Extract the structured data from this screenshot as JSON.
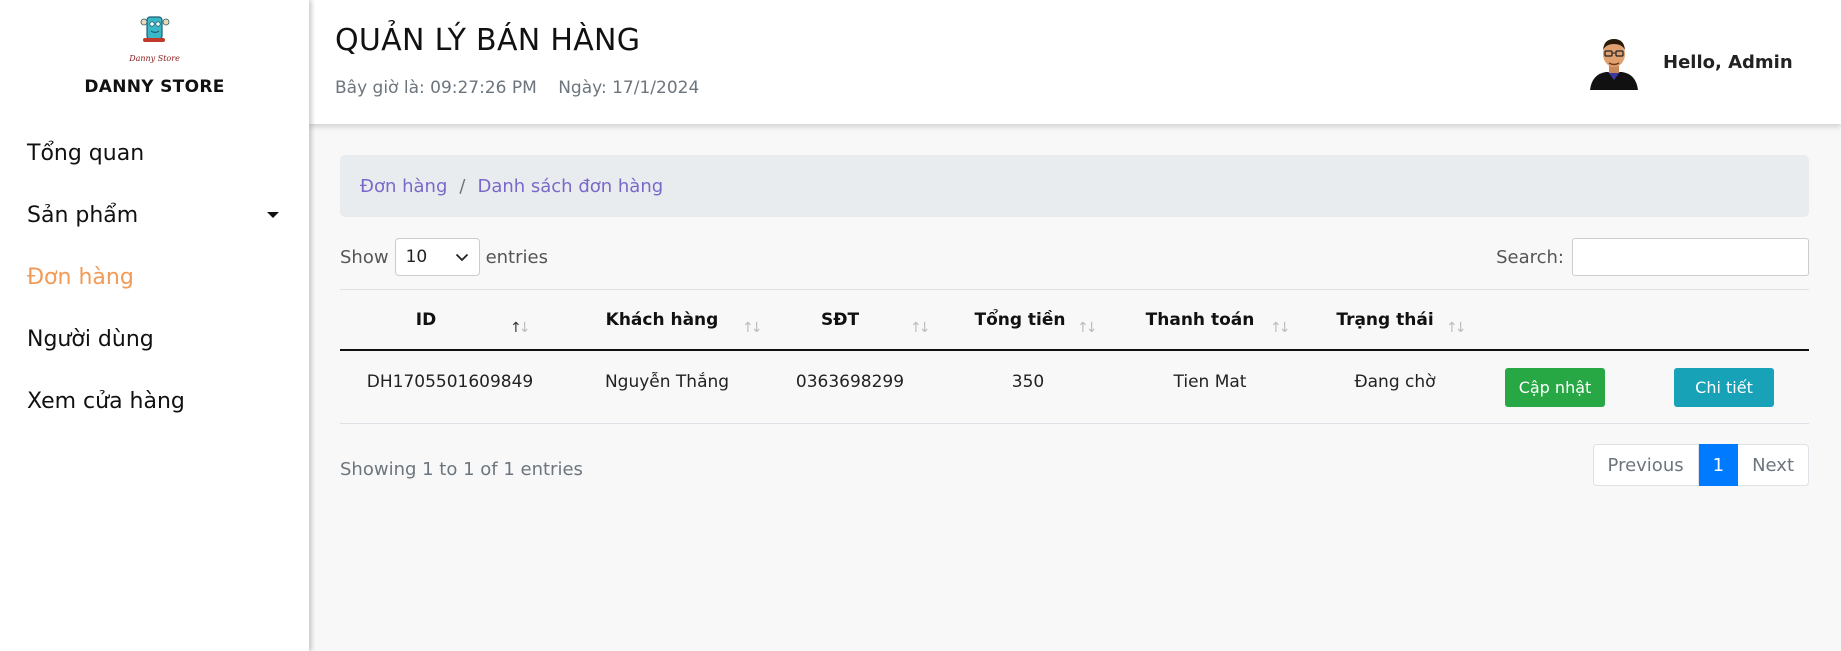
{
  "sidebar": {
    "store_name": "DANNY STORE",
    "logo_text": "Danny Store",
    "items": [
      {
        "label": "Tổng quan",
        "active": false
      },
      {
        "label": "Sản phẩm",
        "active": false,
        "has_dropdown": true
      },
      {
        "label": "Đơn hàng",
        "active": true
      },
      {
        "label": "Người dùng",
        "active": false
      },
      {
        "label": "Xem cửa hàng",
        "active": false
      }
    ]
  },
  "header": {
    "title": "QUẢN LÝ BÁN HÀNG",
    "time_text": "Bây giờ là: 09:27:26 PM",
    "date_text": "Ngày: 17/1/2024",
    "greeting": "Hello, Admin"
  },
  "breadcrumb": {
    "items": [
      "Đơn hàng",
      "Danh sách đơn hàng"
    ],
    "separator": "/"
  },
  "controls": {
    "show_label": "Show",
    "page_size": "10",
    "entries_label": "entries",
    "search_label": "Search:",
    "search_value": ""
  },
  "table": {
    "columns": [
      "ID",
      "Khách hàng",
      "SĐT",
      "Tổng tiền",
      "Thanh toán",
      "Trạng thái"
    ],
    "rows": [
      {
        "id": "DH1705501609849",
        "customer": "Nguyễn Thắng",
        "phone": "0363698299",
        "total": "350",
        "payment": "Tien Mat",
        "status": "Đang chờ",
        "update_label": "Cập nhật",
        "detail_label": "Chi tiết"
      }
    ]
  },
  "footer": {
    "info": "Showing 1 to 1 of 1 entries",
    "previous_label": "Previous",
    "current_page": "1",
    "next_label": "Next"
  },
  "colors": {
    "active_nav": "#f29a56",
    "breadcrumb_link": "#7a68c9",
    "update_button": "#28a745",
    "detail_button": "#17a2b8",
    "page_current": "#007bff"
  },
  "icons": {
    "dropdown": "caret-down-icon",
    "select": "chevron-down-icon",
    "sort": "sort-arrows-icon",
    "avatar": "user-avatar-icon"
  }
}
